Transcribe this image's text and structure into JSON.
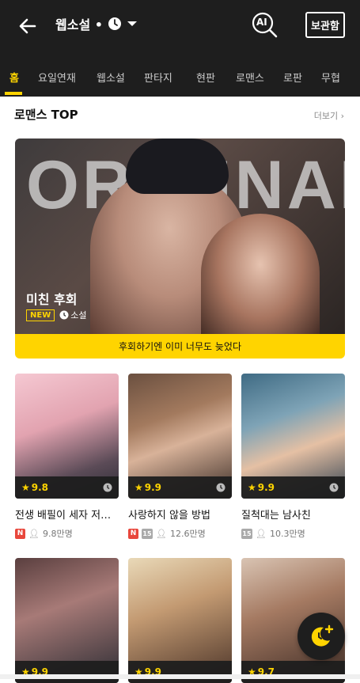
{
  "header": {
    "title": "웹소설 •",
    "ai_label": "AI",
    "save_label": "보관함"
  },
  "tabs": [
    {
      "label": "홈",
      "active": true
    },
    {
      "label": "요일연재"
    },
    {
      "label": "웹소설"
    },
    {
      "label": "판타지"
    },
    {
      "label": "현판"
    },
    {
      "label": "로맨스"
    },
    {
      "label": "로판"
    },
    {
      "label": "무협"
    }
  ],
  "section": {
    "title": "로맨스 TOP",
    "more_label": "더보기"
  },
  "banner": {
    "bg_text": "ORIGINAL",
    "title": "미친 후회",
    "badge": "NEW",
    "genre": "소설",
    "tagline": "후회하기엔 이미 너무도 늦었다"
  },
  "cards": [
    {
      "title": "전생 배필이 세자 저…",
      "rating": "9.8",
      "badges": [
        "N"
      ],
      "readers": "9.8만명"
    },
    {
      "title": "사랑하지 않을 방법",
      "rating": "9.9",
      "badges": [
        "N",
        "15"
      ],
      "readers": "12.6만명"
    },
    {
      "title": "질척대는 남사친",
      "rating": "9.9",
      "badges": [
        "15"
      ],
      "readers": "10.3만명"
    },
    {
      "title": "",
      "rating": "9.9",
      "badges": [],
      "readers": ""
    },
    {
      "title": "",
      "rating": "9.9",
      "badges": [],
      "readers": ""
    },
    {
      "title": "",
      "rating": "9.7",
      "badges": [],
      "readers": ""
    }
  ],
  "colors": {
    "header_bg": "#1e1e1e",
    "accent": "#ffd400",
    "badge_new": "#e8473c"
  }
}
